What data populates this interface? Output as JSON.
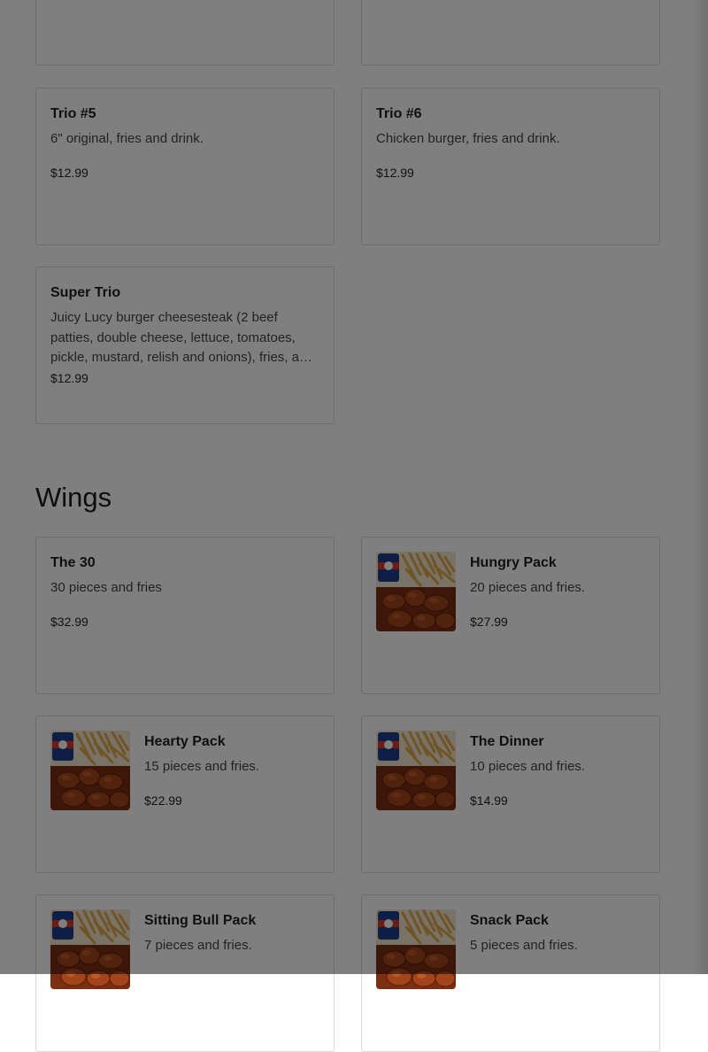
{
  "trios": [
    {
      "name": "Trio #5",
      "description": "6\" original, fries and drink.",
      "price": "$12.99"
    },
    {
      "name": "Trio #6",
      "description": "Chicken burger, fries and drink.",
      "price": "$12.99"
    },
    {
      "name": "Super Trio",
      "description": "Juicy Lucy burger cheesesteak (2 beef patties, double cheese, lettuce, tomatoes, pickle, mustard, relish and onions), fries, a…",
      "price": "$12.99"
    }
  ],
  "wings": {
    "title": "Wings",
    "items": [
      {
        "name": "The 30",
        "description": "30 pieces and fries",
        "price": "$32.99",
        "image": "none"
      },
      {
        "name": "Hungry Pack",
        "description": "20 pieces and fries.",
        "price": "$27.99",
        "image": "wings-fries-drink-photo"
      },
      {
        "name": "Hearty Pack",
        "description": "15 pieces and fries.",
        "price": "$22.99",
        "image": "wings-fries-drink-photo"
      },
      {
        "name": "The Dinner",
        "description": "10 pieces and fries.",
        "price": "$14.99",
        "image": "wings-fries-drink-photo"
      },
      {
        "name": "Sitting Bull Pack",
        "description": "7 pieces and fries.",
        "price": "",
        "image": "wings-fries-drink-photo"
      },
      {
        "name": "Snack Pack",
        "description": "5 pieces and fries.",
        "price": "",
        "image": "wings-fries-drink-photo"
      }
    ]
  },
  "colors": {
    "overlay": "#000000",
    "card_border": "#d9d9d9",
    "wing_sauce": "#8a3b1a",
    "fries": "#d9a441"
  }
}
